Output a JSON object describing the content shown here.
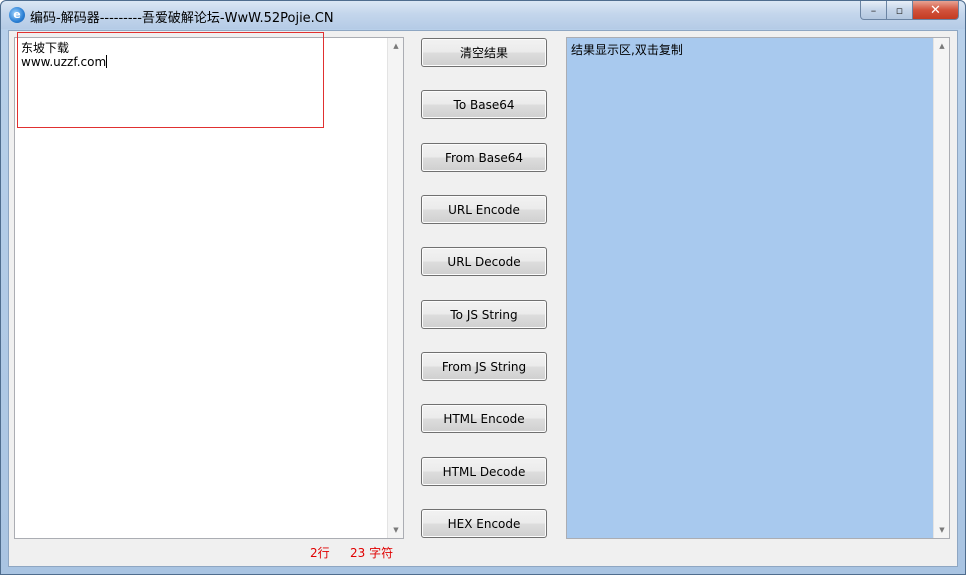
{
  "window": {
    "title": "编码-解码器---------吾爱破解论坛-WwW.52Pojie.CN",
    "app_icon": "e",
    "controls": {
      "minimize": "–",
      "maximize": "▫",
      "close": "✕"
    }
  },
  "input": {
    "line1": "东坡下载",
    "line2": "www.uzzf.com"
  },
  "buttons": [
    "清空结果",
    "To Base64",
    "From Base64",
    "URL Encode",
    "URL Decode",
    "To JS String",
    "From JS String",
    "HTML Encode",
    "HTML Decode",
    "HEX Encode"
  ],
  "result": {
    "placeholder": "结果显示区,双击复制"
  },
  "status": {
    "lines": "2行",
    "chars": "23 字符"
  },
  "scroll": {
    "up": "▲",
    "down": "▼"
  },
  "colors": {
    "result_bg": "#a8c9ee",
    "status_text": "#e00000",
    "highlight_box": "#e03030"
  }
}
